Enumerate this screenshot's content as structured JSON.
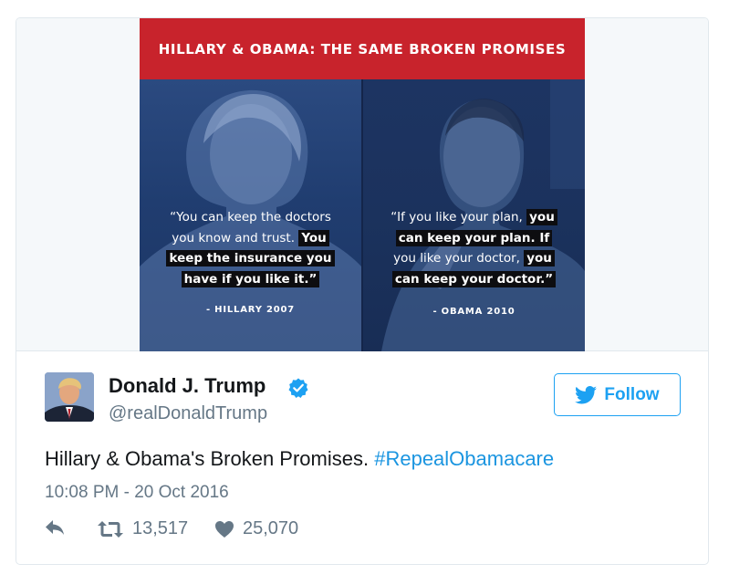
{
  "media": {
    "banner": "HILLARY & OBAMA: THE SAME BROKEN PROMISES",
    "left": {
      "quote_plain": "“You can keep the doctors",
      "quote_plain2": "you know and trust.",
      "quote_hl1": "You",
      "quote_hl2": "keep the insurance you",
      "quote_hl3": "have if you like it.”",
      "attribution": "- HILLARY 2007"
    },
    "right": {
      "line1_plain": "“If you like your plan,",
      "line1_hl": "you",
      "line2_hl": "can keep your plan. If",
      "line3_plain": "you like your doctor,",
      "line3_hl": "you",
      "line4_hl": "can keep your doctor.”",
      "attribution": "- OBAMA 2010"
    }
  },
  "author": {
    "display_name": "Donald J. Trump",
    "handle": "@realDonaldTrump",
    "verified_icon": "verified-badge-icon"
  },
  "follow_button": {
    "label": "Follow",
    "icon": "twitter-bird-icon"
  },
  "tweet": {
    "text": "Hillary & Obama's Broken Promises.",
    "hashtag": "#RepealObamacare",
    "timestamp": "10:08 PM - 20 Oct 2016"
  },
  "actions": {
    "reply_icon": "reply-icon",
    "retweet_icon": "retweet-icon",
    "retweet_count": "13,517",
    "like_icon": "heart-icon",
    "like_count": "25,070"
  },
  "colors": {
    "accent": "#1da1f2",
    "hashtag": "#1b95e0",
    "banner_red": "#c8232c",
    "panel_navy": "#203a6d",
    "muted_text": "#657786"
  }
}
